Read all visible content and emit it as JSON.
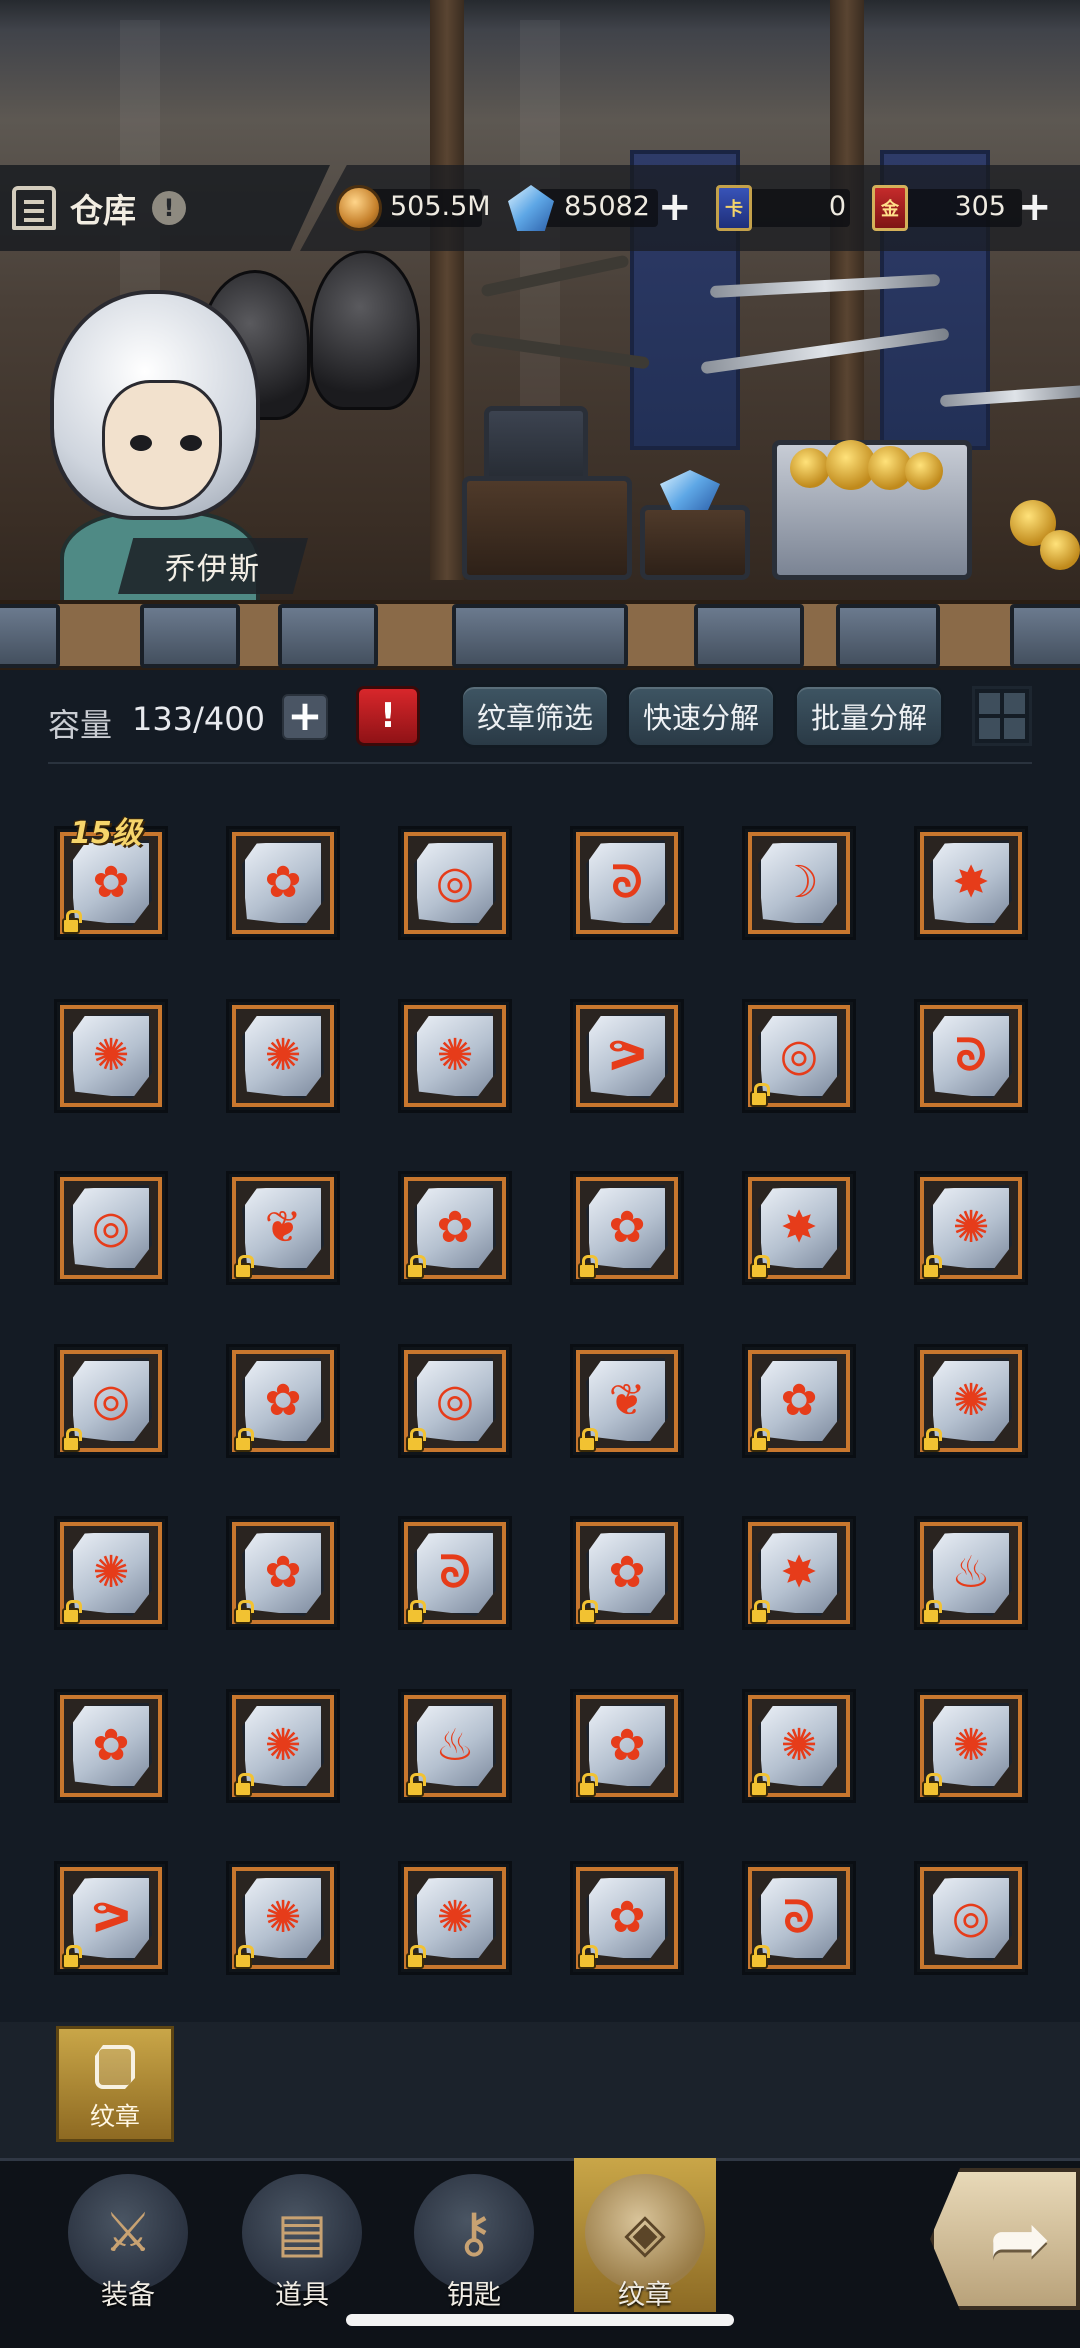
{
  "hud": {
    "title": "仓库",
    "info_icon": "!",
    "currencies": [
      {
        "name": "coin-icon",
        "value": "505.5M",
        "plus": ""
      },
      {
        "name": "gem-icon",
        "value": "85082",
        "plus": "+"
      },
      {
        "name": "blue-card-icon",
        "label": "卡",
        "value": "0",
        "plus": ""
      },
      {
        "name": "red-card-icon",
        "label": "金",
        "value": "305",
        "plus": "+"
      }
    ]
  },
  "hero": {
    "name": "乔伊斯"
  },
  "toolbar": {
    "capacity_label": "容量",
    "capacity_value": "133/400",
    "plus": "+",
    "alert": "!",
    "filter_button": "纹章筛选",
    "quick_decompose_button": "快速分解",
    "batch_decompose_button": "批量分解"
  },
  "level_badge": "15级",
  "emblems": [
    {
      "g": "✿",
      "lock": true
    },
    {
      "g": "✿",
      "lock": false
    },
    {
      "g": "◎",
      "lock": false
    },
    {
      "g": "ᘐ",
      "lock": false
    },
    {
      "g": "☽",
      "lock": false
    },
    {
      "g": "✸",
      "lock": false
    },
    {
      "g": "✺",
      "lock": false
    },
    {
      "g": "✺",
      "lock": false
    },
    {
      "g": "✺",
      "lock": false
    },
    {
      "g": "ᕗ",
      "lock": false
    },
    {
      "g": "◎",
      "lock": true
    },
    {
      "g": "ᘐ",
      "lock": false
    },
    {
      "g": "◎",
      "lock": false
    },
    {
      "g": "❦",
      "lock": true
    },
    {
      "g": "✿",
      "lock": true
    },
    {
      "g": "✿",
      "lock": true
    },
    {
      "g": "✸",
      "lock": true
    },
    {
      "g": "✺",
      "lock": true
    },
    {
      "g": "◎",
      "lock": true
    },
    {
      "g": "✿",
      "lock": true
    },
    {
      "g": "◎",
      "lock": true
    },
    {
      "g": "❦",
      "lock": true
    },
    {
      "g": "✿",
      "lock": true
    },
    {
      "g": "✺",
      "lock": true
    },
    {
      "g": "✺",
      "lock": true
    },
    {
      "g": "✿",
      "lock": true
    },
    {
      "g": "ᘐ",
      "lock": true
    },
    {
      "g": "✿",
      "lock": true
    },
    {
      "g": "✸",
      "lock": true
    },
    {
      "g": "♨",
      "lock": true
    },
    {
      "g": "✿",
      "lock": false
    },
    {
      "g": "✺",
      "lock": true
    },
    {
      "g": "♨",
      "lock": true
    },
    {
      "g": "✿",
      "lock": true
    },
    {
      "g": "✺",
      "lock": true
    },
    {
      "g": "✺",
      "lock": true
    },
    {
      "g": "ᕗ",
      "lock": true
    },
    {
      "g": "✺",
      "lock": true
    },
    {
      "g": "✺",
      "lock": true
    },
    {
      "g": "✿",
      "lock": true
    },
    {
      "g": "ᘐ",
      "lock": true
    },
    {
      "g": "◎",
      "lock": false
    }
  ],
  "category_tab": {
    "label": "纹章"
  },
  "bottom_nav": [
    {
      "label": "装备",
      "icon": "equipment-icon",
      "glyph": "⚔"
    },
    {
      "label": "道具",
      "icon": "items-chest-icon",
      "glyph": "▤"
    },
    {
      "label": "钥匙",
      "icon": "key-icon",
      "glyph": "⚷"
    },
    {
      "label": "纹章",
      "icon": "emblem-icon",
      "glyph": "◈"
    }
  ],
  "forward_icon": "➦"
}
